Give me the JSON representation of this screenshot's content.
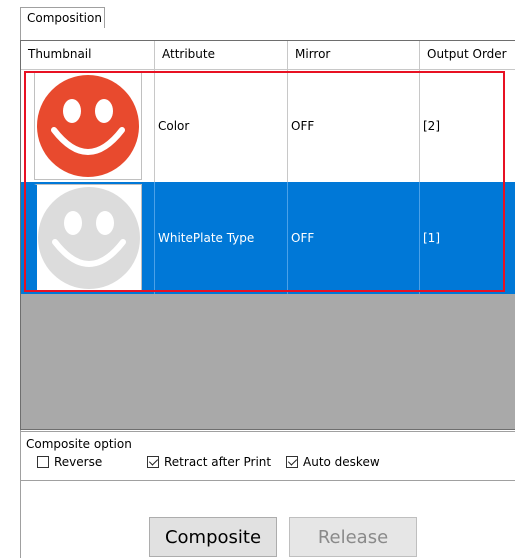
{
  "tab": {
    "label": "Composition"
  },
  "grid": {
    "columns": [
      "Thumbnail",
      "Attribute",
      "Mirror",
      "Output Order"
    ],
    "rows": [
      {
        "thumbnail": "red-smiley-icon",
        "attribute": "Color",
        "mirror": "OFF",
        "order": "[2]",
        "selected": false
      },
      {
        "thumbnail": "gray-smiley-icon",
        "attribute": "WhitePlate Type",
        "mirror": "OFF",
        "order": "[1]",
        "selected": true
      }
    ]
  },
  "options": {
    "title": "Composite option",
    "reverse": {
      "label": "Reverse",
      "checked": false
    },
    "retract": {
      "label": "Retract after Print",
      "checked": true
    },
    "deskew": {
      "label": "Auto deskew",
      "checked": true
    }
  },
  "buttons": {
    "composite": "Composite",
    "release": "Release"
  },
  "colors": {
    "selection": "#0078d7",
    "highlight_outline": "#e81123",
    "smiley_red": "#e84a2e",
    "smiley_gray": "#dcdcdc"
  }
}
